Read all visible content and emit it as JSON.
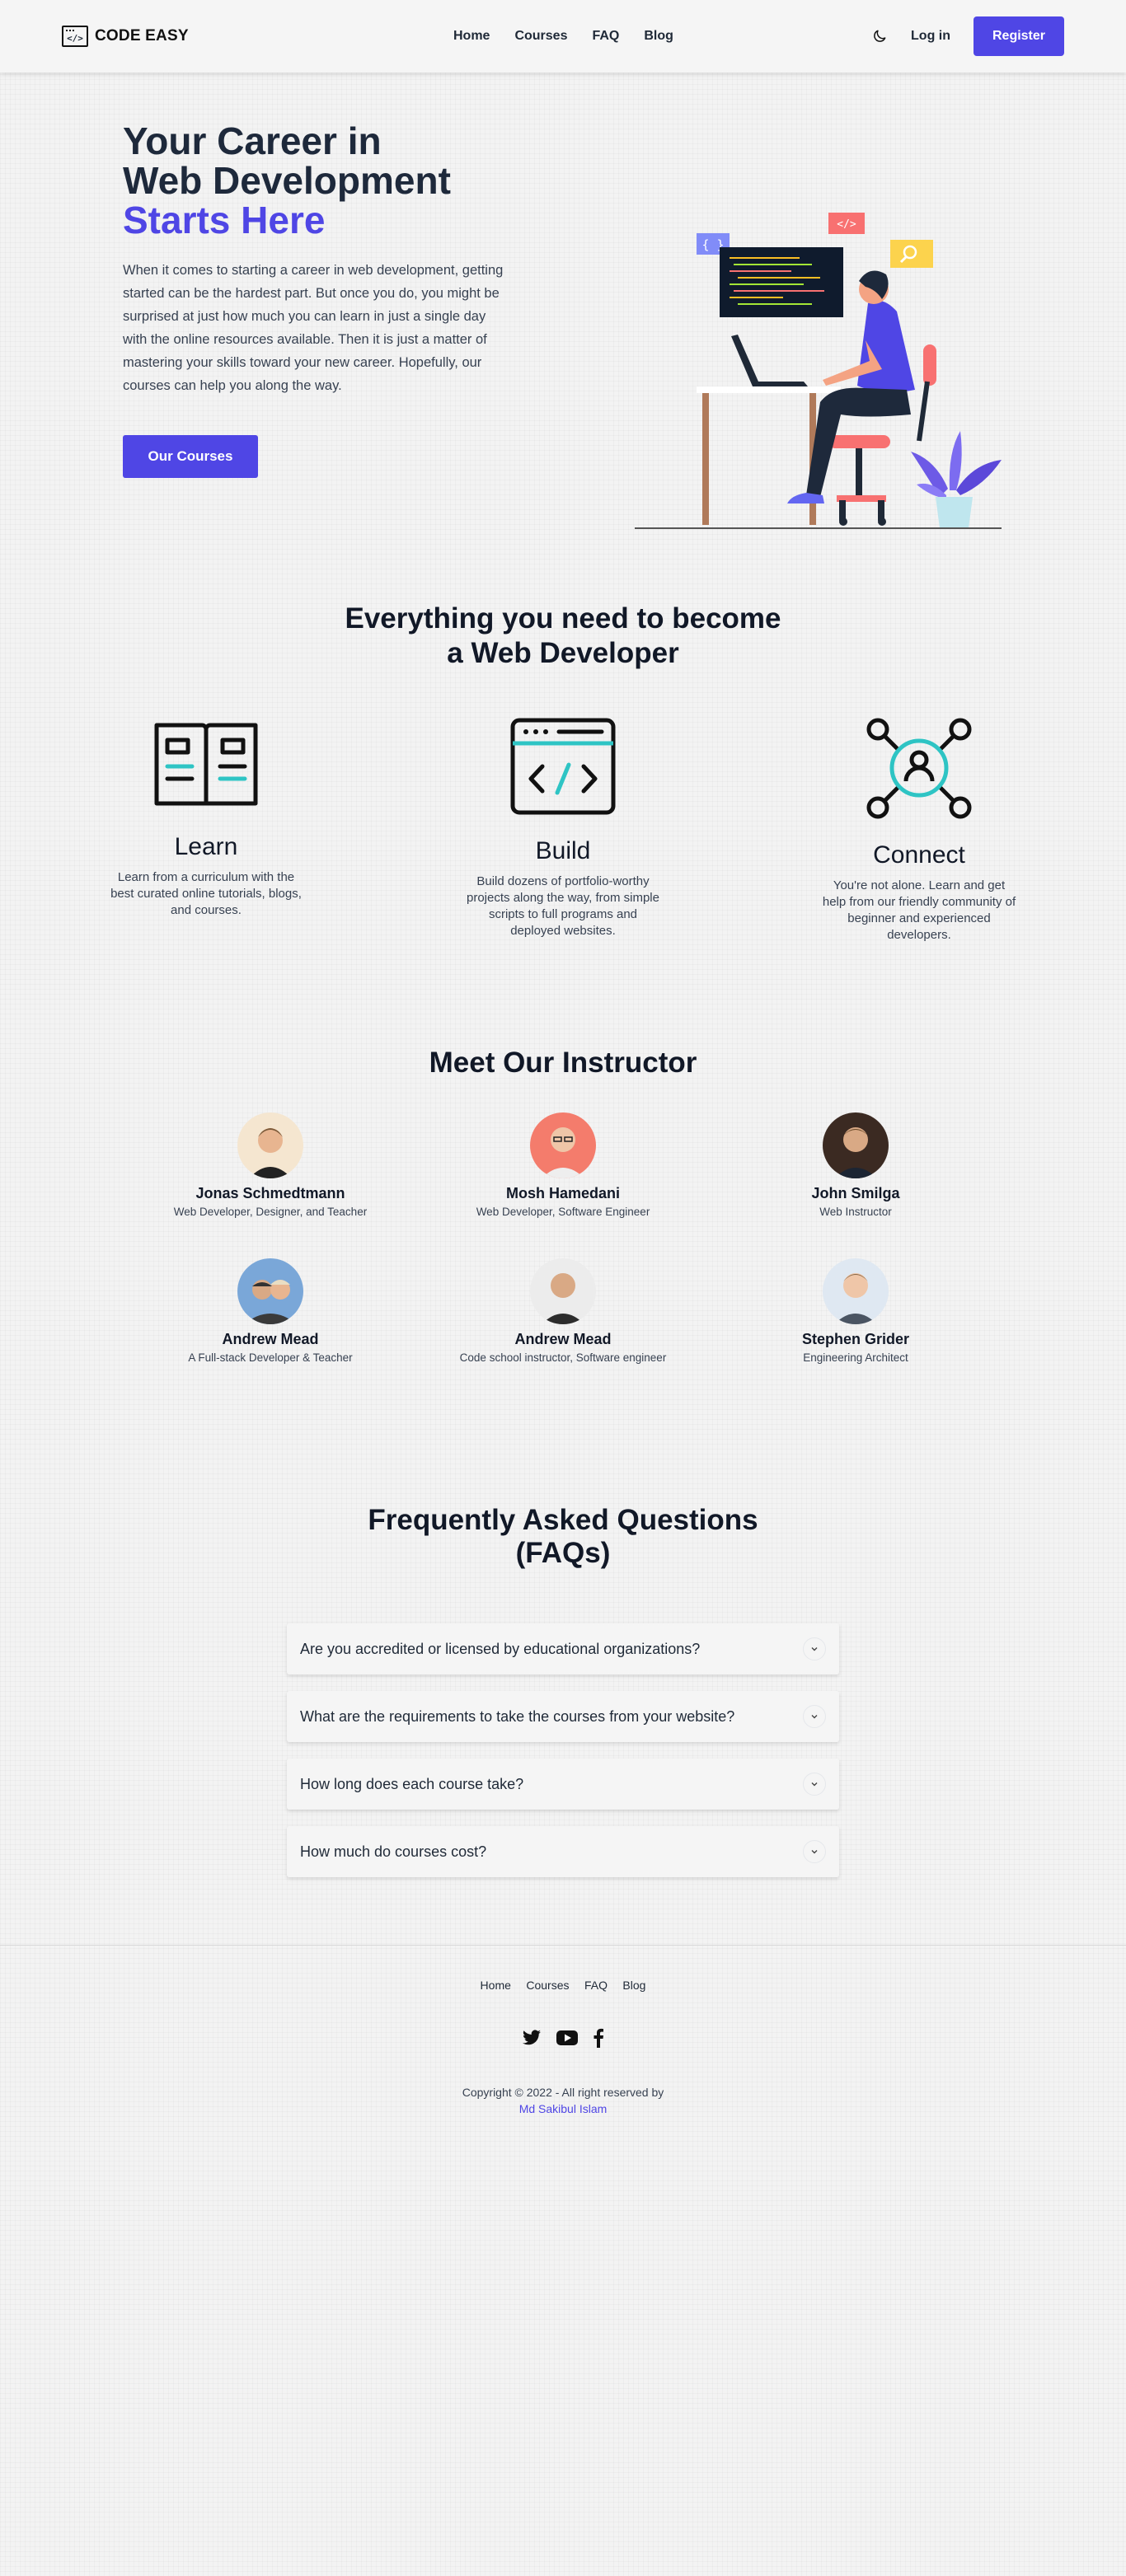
{
  "header": {
    "logo_glyph": "</>",
    "logo_text": "CODE EASY",
    "nav": [
      "Home",
      "Courses",
      "FAQ",
      "Blog"
    ],
    "theme_icon": "moon-icon",
    "login": "Log in",
    "register": "Register"
  },
  "hero": {
    "title_line1": "Your Career in",
    "title_line2": "Web Development",
    "title_line3": "Starts Here",
    "text": "When it comes to starting a career in web development, getting started can be the hardest part. But once you do, you might be surprised at just how much you can learn in just a single day with the online resources available. Then it is just a matter of mastering your skills toward your new career. Hopefully, our courses can help you along the way.",
    "button": "Our Courses",
    "illu_tags": [
      "{ }",
      "</>"
    ]
  },
  "features": {
    "title_line1": "Everything you need to become",
    "title_line2": "a Web Developer",
    "items": [
      {
        "title": "Learn",
        "text": "Learn from a curriculum with the best curated online tutorials, blogs, and courses.",
        "icon": "open-book-icon"
      },
      {
        "title": "Build",
        "text": "Build dozens of portfolio-worthy projects along the way, from simple scripts to full programs and deployed websites.",
        "icon": "code-window-icon"
      },
      {
        "title": "Connect",
        "text": "You're not alone. Learn and get help from our friendly community of beginner and experienced developers.",
        "icon": "network-user-icon"
      }
    ]
  },
  "instructors": {
    "title": "Meet Our Instructor",
    "items": [
      {
        "name": "Jonas Schmedtmann",
        "role": "Web Developer, Designer, and Teacher"
      },
      {
        "name": "Mosh Hamedani",
        "role": "Web Developer, Software Engineer"
      },
      {
        "name": "John Smilga",
        "role": "Web Instructor"
      },
      {
        "name": "Andrew Mead",
        "role": "A Full-stack Developer & Teacher"
      },
      {
        "name": "Andrew Mead",
        "role": "Code school instructor, Software engineer"
      },
      {
        "name": "Stephen Grider",
        "role": "Engineering Architect"
      }
    ]
  },
  "faq": {
    "title_line1": "Frequently Asked Questions",
    "title_line2": "(FAQs)",
    "items": [
      "Are you accredited or licensed by educational organizations?",
      "What are the requirements to take the courses from your website?",
      "How long does each course take?",
      "How much do courses cost?"
    ]
  },
  "footer": {
    "nav": [
      "Home",
      "Courses",
      "FAQ",
      "Blog"
    ],
    "socials": [
      "twitter-icon",
      "youtube-icon",
      "facebook-icon"
    ],
    "copyright": "Copyright © 2022 - All right reserved by",
    "author": "Md Sakibul Islam"
  },
  "colors": {
    "accent": "#4f46e5",
    "teal": "#2ec4c4",
    "background": "#f3f3f3"
  }
}
